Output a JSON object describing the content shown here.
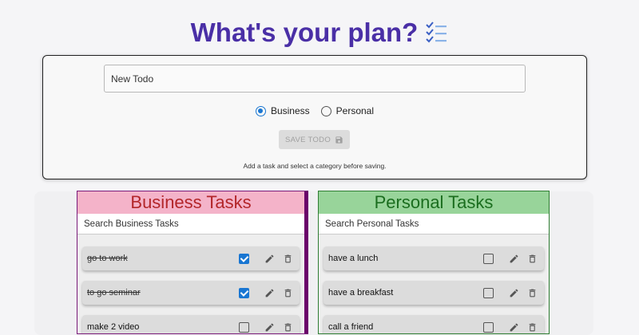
{
  "header": {
    "title": "What's your plan?",
    "icon": "checklist-icon"
  },
  "form": {
    "input_placeholder": "New Todo",
    "options": [
      {
        "label": "Business",
        "selected": true
      },
      {
        "label": "Personal",
        "selected": false
      }
    ],
    "save_label": "SAVE TODO",
    "helper_text": "Add a task and select a category before saving."
  },
  "business": {
    "title": "Business Tasks",
    "search_placeholder": "Search Business Tasks",
    "tasks": [
      {
        "text": "go to work",
        "done": true
      },
      {
        "text": "to go seminar",
        "done": true
      },
      {
        "text": "make 2 video",
        "done": false
      }
    ]
  },
  "personal": {
    "title": "Personal Tasks",
    "search_placeholder": "Search Personal Tasks",
    "tasks": [
      {
        "text": "have a lunch",
        "done": false
      },
      {
        "text": "have a breakfast",
        "done": false
      },
      {
        "text": "call a friend",
        "done": false
      }
    ]
  },
  "colors": {
    "title": "#4a2fa6",
    "accent": "#1976d2",
    "business_header": "#f4b3c9",
    "business_title": "#b3262a",
    "personal_header": "#98d49a",
    "personal_title": "#1b6e1f"
  }
}
